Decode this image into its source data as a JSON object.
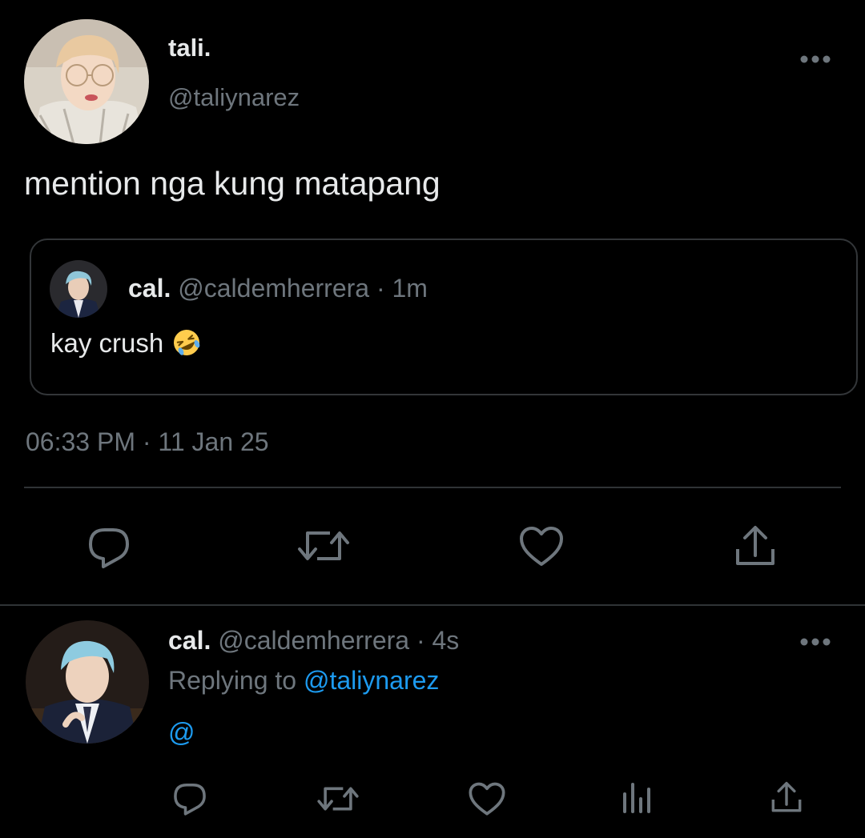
{
  "main_tweet": {
    "display_name": "tali.",
    "handle": "@taliynarez",
    "text": "mention nga kung matapang",
    "timestamp": "06:33 PM · 11 Jan 25",
    "avatar_icon": "avatar-photo-glasses",
    "more_icon": "more-horizontal-icon",
    "quoted_tweet": {
      "display_name": "cal.",
      "handle": "@caldemherrera",
      "separator": "·",
      "time": "1m",
      "text": "kay crush",
      "emoji": "rolling-on-floor-laughing-emoji"
    },
    "actions": [
      "reply-icon",
      "retweet-icon",
      "like-icon",
      "share-icon"
    ]
  },
  "reply_tweet": {
    "display_name": "cal.",
    "handle": "@caldemherrera",
    "separator": "·",
    "time": "4s",
    "replying_label": "Replying to",
    "replying_handle": "@taliynarez",
    "text": "@",
    "more_icon": "more-horizontal-icon",
    "actions": [
      "reply-icon",
      "retweet-icon",
      "like-icon",
      "analytics-icon",
      "share-icon"
    ]
  },
  "colors": {
    "background": "#000000",
    "text_primary": "#e7e9ea",
    "text_secondary": "#6e767d",
    "accent": "#1d9bf0",
    "border": "#2f3336"
  }
}
